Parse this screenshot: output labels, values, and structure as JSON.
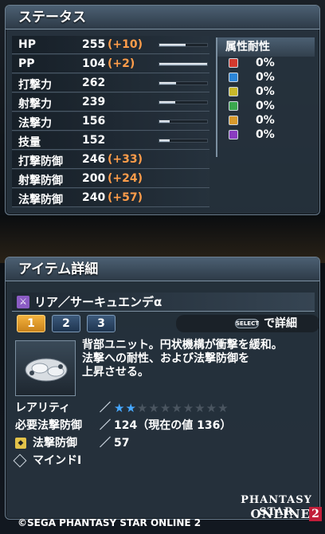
{
  "status": {
    "title": "ステータス",
    "stats": [
      {
        "name": "HP",
        "value": "255",
        "bonus": "(+10)",
        "bar": 0.55
      },
      {
        "name": "PP",
        "value": "104",
        "bonus": "(+2)",
        "bar": 1.0
      },
      {
        "name": "打撃力",
        "value": "262",
        "bonus": "",
        "bar": 0.35
      },
      {
        "name": "射撃力",
        "value": "239",
        "bonus": "",
        "bar": 0.33
      },
      {
        "name": "法撃力",
        "value": "156",
        "bonus": "",
        "bar": 0.22
      },
      {
        "name": "技量",
        "value": "152",
        "bonus": "",
        "bar": 0.22
      },
      {
        "name": "打撃防御",
        "value": "246",
        "bonus": "(+33)",
        "bar": 0.0
      },
      {
        "name": "射撃防御",
        "value": "200",
        "bonus": "(+24)",
        "bar": 0.0
      },
      {
        "name": "法撃防御",
        "value": "240",
        "bonus": "(+57)",
        "bar": 0.0
      }
    ],
    "resistance": {
      "title": "属性耐性",
      "items": [
        {
          "icon": "fire-icon",
          "color": "#d43a2e",
          "glyph": "火",
          "value": "0%"
        },
        {
          "icon": "ice-icon",
          "color": "#2c86d8",
          "glyph": "氷",
          "value": "0%"
        },
        {
          "icon": "lightning-icon",
          "color": "#c8b82a",
          "glyph": "雷",
          "value": "0%"
        },
        {
          "icon": "wind-icon",
          "color": "#3aa84e",
          "glyph": "風",
          "value": "0%"
        },
        {
          "icon": "light-icon",
          "color": "#d89a2c",
          "glyph": "光",
          "value": "0%"
        },
        {
          "icon": "dark-icon",
          "color": "#8a3cc0",
          "glyph": "闇",
          "value": "0%"
        }
      ]
    }
  },
  "item": {
    "title": "アイテム詳細",
    "name": "リア／サーキュエンデα",
    "tabs": [
      "1",
      "2",
      "3"
    ],
    "select_label": "SELECT",
    "select_text": "で詳細",
    "description": [
      "背部ユニット。円状機構が衝撃を緩和。",
      "法撃への耐性、および法撃防御を",
      "上昇させる。"
    ],
    "rarity_label": "レアリティ",
    "rarity": 2,
    "rarity_max": 10,
    "requirement_label": "必要法撃防御",
    "requirement_value": "124（現在の値 136）",
    "defense_label": "法撃防御",
    "defense_value": "57",
    "affix_label": "マインドⅠ",
    "separator": "／"
  },
  "footer": {
    "copyright": "©SEGA PHANTASY STAR ONLINE 2",
    "logo_line1": "PHANTASY STAR",
    "logo_line2": "ONLINE",
    "logo_num": "2"
  },
  "colors": {
    "bonus": "#ff9d4a",
    "accent_tab": "#f3b23e",
    "star_on": "#46a8ff"
  }
}
